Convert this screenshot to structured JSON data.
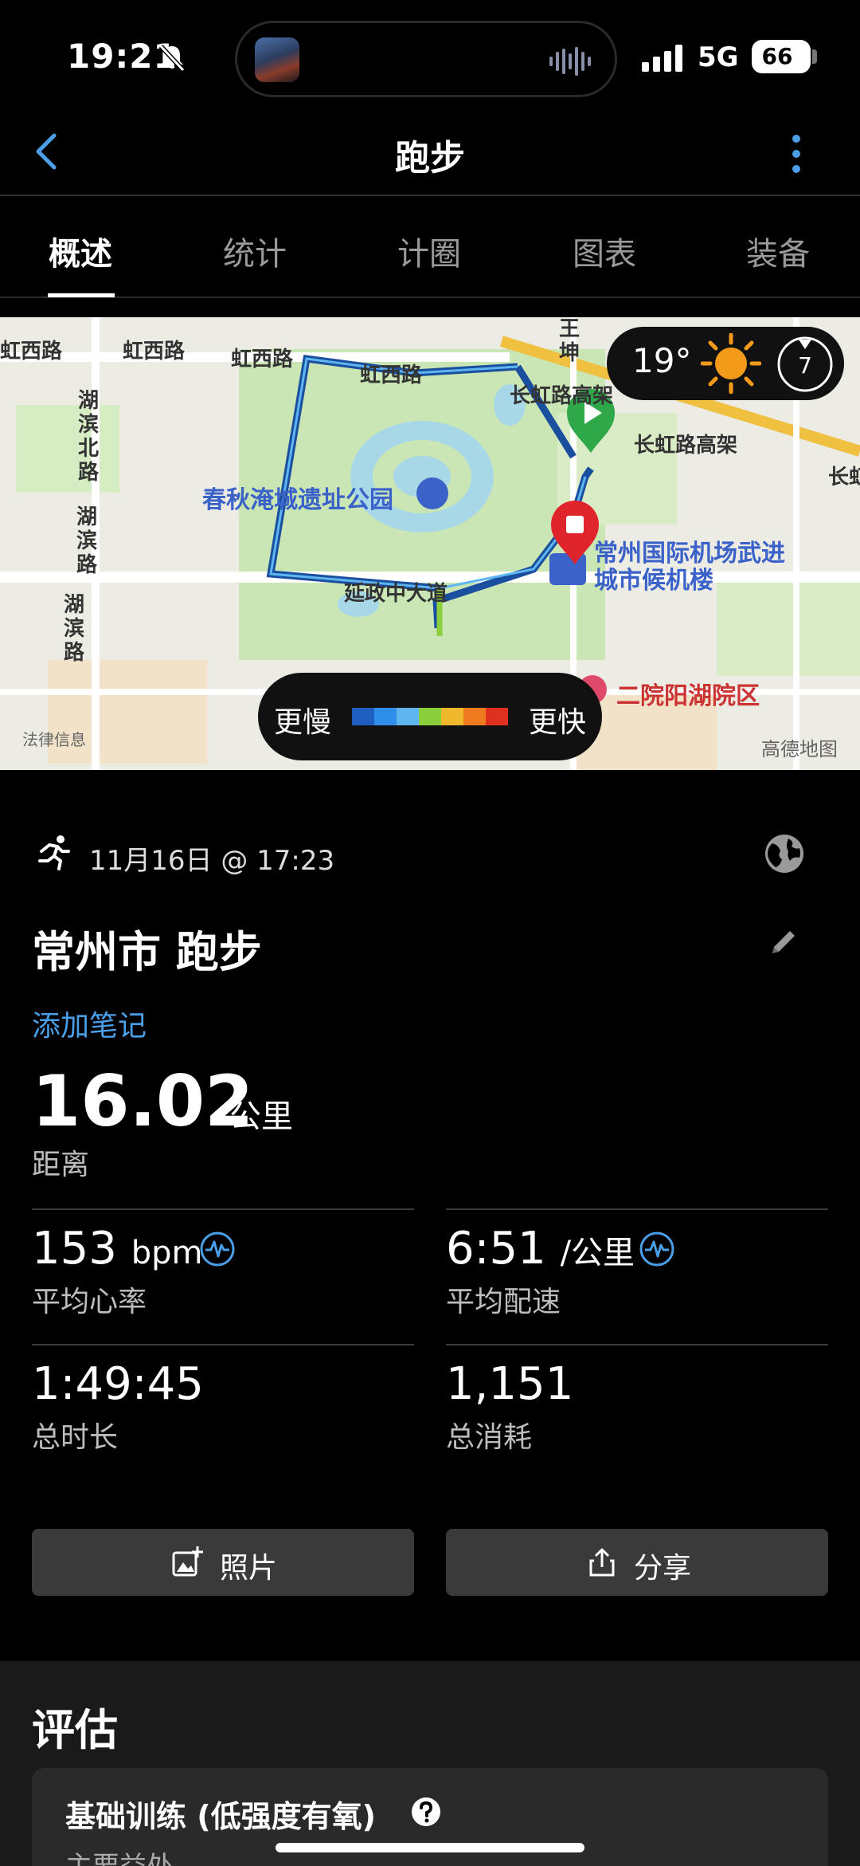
{
  "status_bar": {
    "time": "19:21",
    "network": "5G",
    "battery": "66"
  },
  "header": {
    "title": "跑步"
  },
  "tabs": [
    {
      "label": "概述",
      "active": true
    },
    {
      "label": "统计",
      "active": false
    },
    {
      "label": "计圈",
      "active": false
    },
    {
      "label": "图表",
      "active": false
    },
    {
      "label": "装备",
      "active": false
    }
  ],
  "map": {
    "labels": {
      "hongxi_1": "虹西路",
      "hongxi_2": "虹西路",
      "hongxi_3": "虹西路",
      "hongxi_4": "虹西路",
      "hubin_north": "湖滨北路",
      "hubin_1": "湖滨路",
      "hubin_2": "湖滨路",
      "park": "春秋淹城遗址公园",
      "changhong_1": "长虹路高架",
      "changhong_2": "长虹路高架",
      "chang_edge": "长虹",
      "wang": "王坤",
      "yanzheng": "延政中大道",
      "airport": "常州国际机场武进城市候机楼",
      "hospital": "二院阳湖院区",
      "legal": "法律信息",
      "amap": "高德地图"
    },
    "weather": {
      "temperature": "19°",
      "wind": "7"
    },
    "legend": {
      "slow": "更慢",
      "fast": "更快",
      "colors": [
        "#1f5fbf",
        "#2f8fe8",
        "#5fb5f0",
        "#8ccf3c",
        "#f0b82c",
        "#f07a20",
        "#e03020"
      ]
    },
    "colors": {
      "route": "#1a4fa0",
      "start": "#2fa84a",
      "end": "#e0242c"
    }
  },
  "activity": {
    "date": "11月16日 @ 17:23",
    "title": "常州市 跑步",
    "add_note": "添加笔记",
    "distance": {
      "value": "16.02",
      "unit": "公里",
      "label": "距离"
    },
    "heart_rate": {
      "value": "153",
      "unit": "bpm",
      "label": "平均心率"
    },
    "pace": {
      "value": "6:51",
      "unit": "/公里",
      "label": "平均配速"
    },
    "duration": {
      "value": "1:49:45",
      "label": "总时长"
    },
    "calories": {
      "value": "1,151",
      "label": "总消耗"
    }
  },
  "actions": {
    "photos": "照片",
    "share": "分享"
  },
  "evaluation": {
    "heading": "评估",
    "card_title": "基础训练 (低强度有氧)",
    "card_sub": "主要益处"
  },
  "colors": {
    "accent": "#4a9fe8"
  }
}
